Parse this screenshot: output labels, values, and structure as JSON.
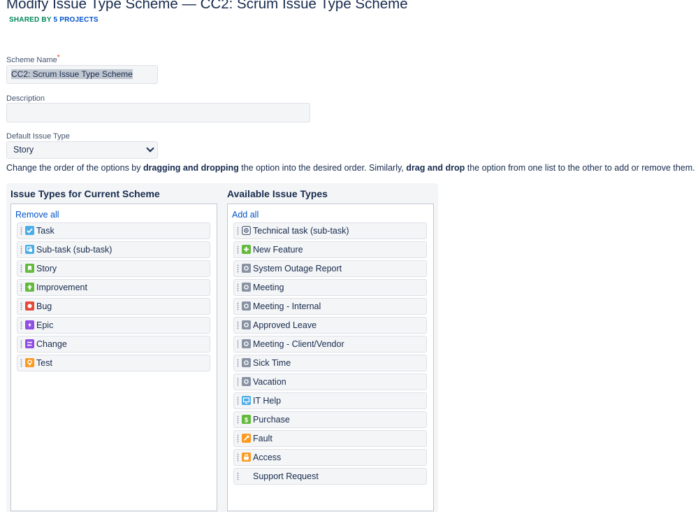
{
  "header": {
    "title": "Modify Issue Type Scheme — CC2: Scrum Issue Type Scheme",
    "shared_prefix": "SHARED BY ",
    "shared_link": "5 PROJECTS"
  },
  "form": {
    "scheme_name_label": "Scheme Name",
    "scheme_name_required": "*",
    "scheme_name_value": "CC2: Scrum Issue Type Scheme",
    "description_label": "Description",
    "description_value": "",
    "default_issue_type_label": "Default Issue Type",
    "default_issue_type_value": "Story"
  },
  "instructions": {
    "p1": "Change the order of the options by ",
    "b1": "dragging and dropping",
    "p2": " the option into the desired order. Similarly, ",
    "b2": "drag and drop",
    "p3": " the option from one list to the other to add or remove them."
  },
  "current": {
    "heading": "Issue Types for Current Scheme",
    "action": "Remove all",
    "items": [
      {
        "label": "Task",
        "icon": "task-icon",
        "color": "#4bade8"
      },
      {
        "label": "Sub-task (sub-task)",
        "icon": "subtask-icon",
        "color": "#4bade8"
      },
      {
        "label": "Story",
        "icon": "story-icon",
        "color": "#63ba3c"
      },
      {
        "label": "Improvement",
        "icon": "improvement-icon",
        "color": "#63ba3c"
      },
      {
        "label": "Bug",
        "icon": "bug-icon",
        "color": "#e5493a"
      },
      {
        "label": "Epic",
        "icon": "epic-icon",
        "color": "#904ee2"
      },
      {
        "label": "Change",
        "icon": "change-icon",
        "color": "#904ee2"
      },
      {
        "label": "Test",
        "icon": "test-icon",
        "color": "#ff991f"
      }
    ]
  },
  "available": {
    "heading": "Available Issue Types",
    "action": "Add all",
    "items": [
      {
        "label": "Technical task (sub-task)",
        "icon": "technical-task-icon",
        "color": "#ffffff"
      },
      {
        "label": "New Feature",
        "icon": "new-feature-icon",
        "color": "#63ba3c"
      },
      {
        "label": "System Outage Report",
        "icon": "generic-issue-icon",
        "color": "#8993a4"
      },
      {
        "label": "Meeting",
        "icon": "generic-issue-icon",
        "color": "#8993a4"
      },
      {
        "label": "Meeting - Internal",
        "icon": "generic-issue-icon",
        "color": "#8993a4"
      },
      {
        "label": "Approved Leave",
        "icon": "generic-issue-icon",
        "color": "#8993a4"
      },
      {
        "label": "Meeting - Client/Vendor",
        "icon": "generic-issue-icon",
        "color": "#8993a4"
      },
      {
        "label": "Sick Time",
        "icon": "generic-issue-icon",
        "color": "#8993a4"
      },
      {
        "label": "Vacation",
        "icon": "generic-issue-icon",
        "color": "#8993a4"
      },
      {
        "label": "IT Help",
        "icon": "it-help-icon",
        "color": "#4bade8"
      },
      {
        "label": "Purchase",
        "icon": "purchase-icon",
        "color": "#63ba3c"
      },
      {
        "label": "Fault",
        "icon": "fault-icon",
        "color": "#ff991f"
      },
      {
        "label": "Access",
        "icon": "access-icon",
        "color": "#ff991f"
      },
      {
        "label": "Support Request",
        "icon": "none",
        "color": ""
      }
    ]
  }
}
